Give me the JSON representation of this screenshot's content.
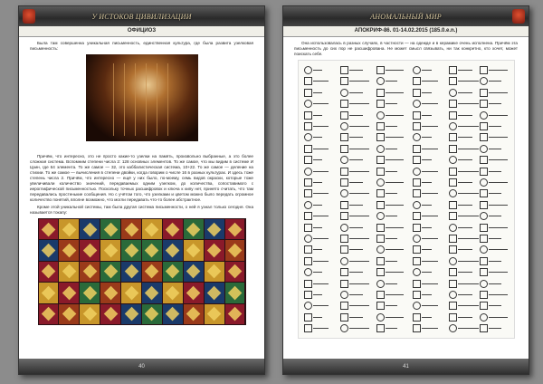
{
  "left_page": {
    "header_title": "У ИСТОКОВ ЦИВИЛИЗАЦИИ",
    "section": "ОФИЦИОЗ",
    "intro_text": "Была там совершенна уникальная письменность, единственная культура, где была развита узелковая письменность:",
    "paragraphs": [
      "Причём, что интересно, это не просто какие-то узелки на память, произвольно выбранные, а это более сложная система. Вспомним степени числа 2: 128 основных элементов. То же самое, что мы видим в системе И Цзин, где 64 элемента. То же самое — 32, это каббалистическая система, 10+22. То же самое — деление на стихии. То же самое — вычисления в степени двойки, когда говорим о числе 16 в разных культурах. И здесь тоже степень числа 2. Причём, что интересно — ещё у них было, по-моему, семь видов окраски, которые тоже увеличивали количество значений, передаваемых одним узелком, до количества, сопоставимого с иероглифической письменностью. Поскольку точных расшифровок и ключа к кипу нет, принято считать, что там передавались простенькие сообщения. Но с учётом того, что узелками и цветом можно было передать огромное количество понятий, вполне возможно, что могли передавать что-то более абстрактное.",
      "Кроме этой уникальной системы, там была другая система письменности, о ней я узнал только сегодня. Она называется токапу:"
    ],
    "page_number": "40"
  },
  "right_page": {
    "header_title": "АНОМАЛЬНЫЙ МИР",
    "section": "АПОКРИФ-86. 01-14.02.2015 (185.0.e.n.)",
    "intro_text": "Она использовалась в разных случаях, в частности — на одежде и в керамике очень исполнена. Причём эта письменность до сих пор не расшифрована. Не может смысл связывать, ни так конкретно, кто хочет, может поискать себе.",
    "page_number": "41"
  },
  "colors": {
    "header_bg": "#2a2a2a",
    "header_text": "#d8c8a0",
    "emblem": "#c03a20",
    "page_bg": "#ffffff",
    "backdrop": "#8c8c8c"
  },
  "icons": [
    "emblem-icon"
  ]
}
